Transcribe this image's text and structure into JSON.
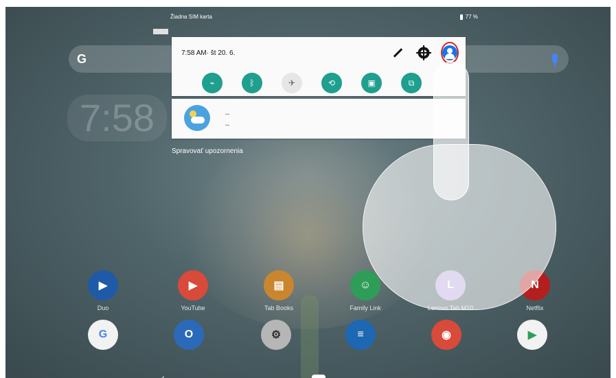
{
  "status_bar": {
    "sim": "Žiadna SIM karta",
    "battery": "77 %"
  },
  "quick_settings": {
    "time_date": "7:58 AM· št 20. 6.",
    "actions": {
      "edit": "edit-icon",
      "settings": "gear-icon",
      "user": "user-icon"
    },
    "tiles": [
      {
        "name": "wifi-off-icon",
        "state": "on"
      },
      {
        "name": "bluetooth-icon",
        "state": "on"
      },
      {
        "name": "airplane-icon",
        "state": "off"
      },
      {
        "name": "rotate-icon",
        "state": "on"
      },
      {
        "name": "reading-mode-icon",
        "state": "on"
      },
      {
        "name": "screen-cast-icon",
        "state": "on"
      }
    ]
  },
  "notification": {
    "line1": "--",
    "line2": "--"
  },
  "manage_notifications": "Spravovať upozornenia",
  "home": {
    "clock": "7:58"
  },
  "apps": [
    {
      "label": "Duo"
    },
    {
      "label": "YouTube"
    },
    {
      "label": "Tab Books"
    },
    {
      "label": "Family Link"
    },
    {
      "label": "Lenovo Tab M10"
    },
    {
      "label": "Netflix"
    }
  ]
}
